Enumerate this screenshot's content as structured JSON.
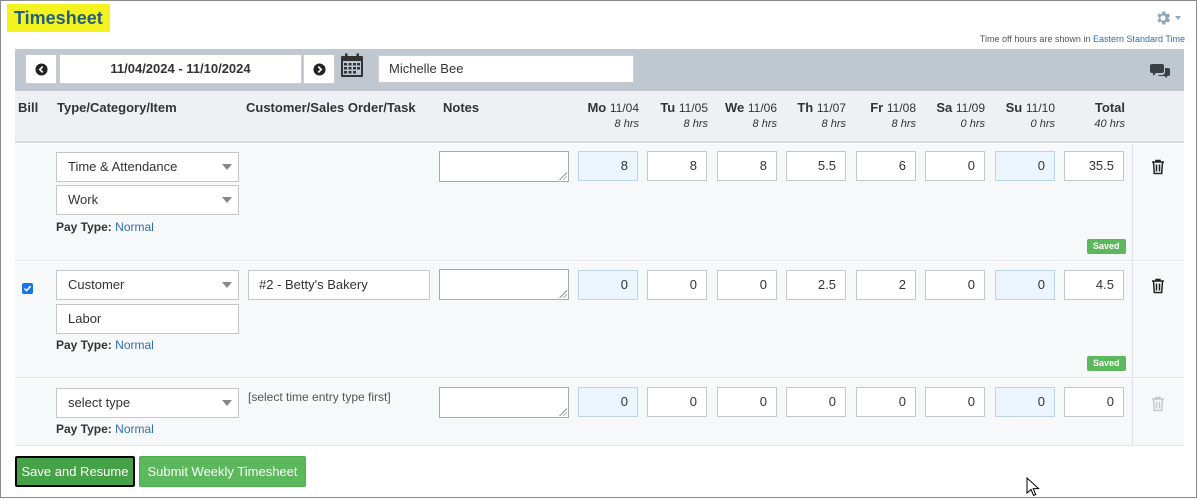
{
  "header": {
    "title": "Timesheet",
    "tz_note_prefix": "Time off hours are shown in",
    "tz_note_link": "Eastern Standard Time"
  },
  "toolbar": {
    "date_range": "11/04/2024 - 11/10/2024",
    "employee": "Michelle Bee"
  },
  "columns": {
    "bill": "Bill",
    "type": "Type/Category/Item",
    "customer": "Customer/Sales Order/Task",
    "notes": "Notes",
    "days": [
      {
        "dow": "Mo",
        "date": "11/04",
        "hrs": "8 hrs"
      },
      {
        "dow": "Tu",
        "date": "11/05",
        "hrs": "8 hrs"
      },
      {
        "dow": "We",
        "date": "11/06",
        "hrs": "8 hrs"
      },
      {
        "dow": "Th",
        "date": "11/07",
        "hrs": "8 hrs"
      },
      {
        "dow": "Fr",
        "date": "11/08",
        "hrs": "8 hrs"
      },
      {
        "dow": "Sa",
        "date": "11/09",
        "hrs": "0 hrs"
      },
      {
        "dow": "Su",
        "date": "11/10",
        "hrs": "0 hrs"
      }
    ],
    "total": "Total",
    "total_hrs": "40 hrs"
  },
  "rows": [
    {
      "type": "Time & Attendance",
      "category": "Work",
      "pay_type_label": "Pay Type:",
      "pay_type": "Normal",
      "hours": [
        "8",
        "8",
        "8",
        "5.5",
        "6",
        "0",
        "0"
      ],
      "total": "35.5",
      "status": "Saved"
    },
    {
      "billable": true,
      "type": "Customer",
      "customer": "#2 - Betty's Bakery",
      "category": "Labor",
      "pay_type_label": "Pay Type:",
      "pay_type": "Normal",
      "hours": [
        "0",
        "0",
        "0",
        "2.5",
        "2",
        "0",
        "0"
      ],
      "total": "4.5",
      "status": "Saved"
    },
    {
      "type": "select type",
      "customer_hint": "[select time entry type first]",
      "pay_type_label": "Pay Type:",
      "pay_type": "Normal",
      "hours": [
        "0",
        "0",
        "0",
        "0",
        "0",
        "0",
        "0"
      ],
      "total": "0"
    }
  ],
  "actions": {
    "save": "Save and Resume",
    "submit": "Submit Weekly Timesheet"
  },
  "colors": {
    "title_highlight": "#f5f31f",
    "title_text": "#1f5f7a",
    "toolbar_bg": "#bfc7d0",
    "saved_badge": "#5cb85c",
    "primary_button": "#46a246",
    "link": "#2e6fb1"
  }
}
